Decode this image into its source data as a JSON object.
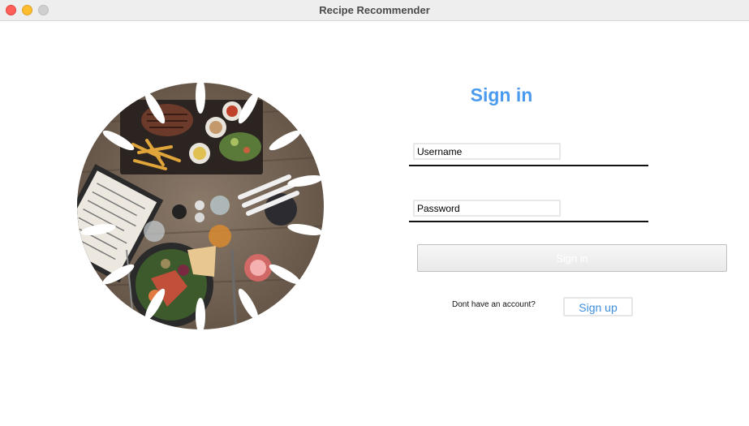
{
  "window": {
    "title": "Recipe Recommender"
  },
  "image": {
    "description_icon": "food-table-photo"
  },
  "signin": {
    "heading": "Sign in",
    "username_value": "Username",
    "password_value": "Password",
    "submit_label": "Sign in",
    "no_account_text": "Dont have an account?",
    "signup_label": "Sign up"
  },
  "colors": {
    "accent": "#4a9bef",
    "link": "#3d8ee0",
    "close": "#fe5f57",
    "minimize": "#febc2e",
    "maximize": "#d0cfcf"
  }
}
